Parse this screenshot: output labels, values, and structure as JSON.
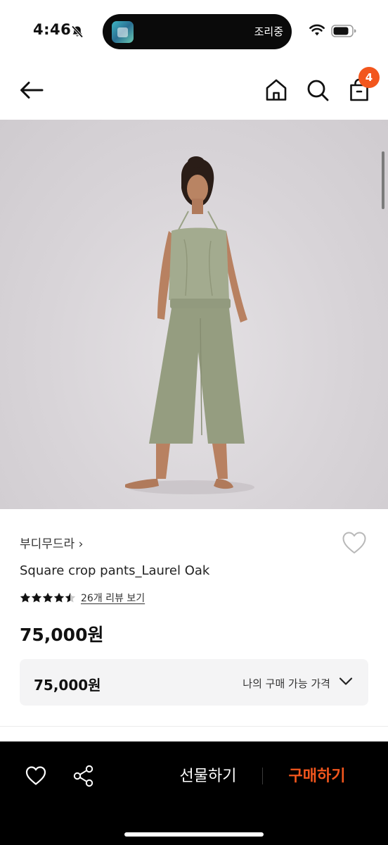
{
  "status_bar": {
    "time": "4:46",
    "island_text": "조리중"
  },
  "nav": {
    "cart_count": "4"
  },
  "product": {
    "brand": "부디무드라 ›",
    "name": "Square crop pants_Laurel Oak",
    "rating": 4.5,
    "rating_max": 5,
    "review_link": "26개 리뷰 보기",
    "price": "75,000원",
    "my_price_value": "75,000원",
    "my_price_label": "나의 구매 가능 가격"
  },
  "bottom_bar": {
    "gift_label": "선물하기",
    "buy_label": "구매하기"
  },
  "colors": {
    "accent": "#f2561d",
    "bottom_bar_bg": "#000000",
    "price_box_bg": "#f4f4f5",
    "garment": "#9aa287"
  }
}
